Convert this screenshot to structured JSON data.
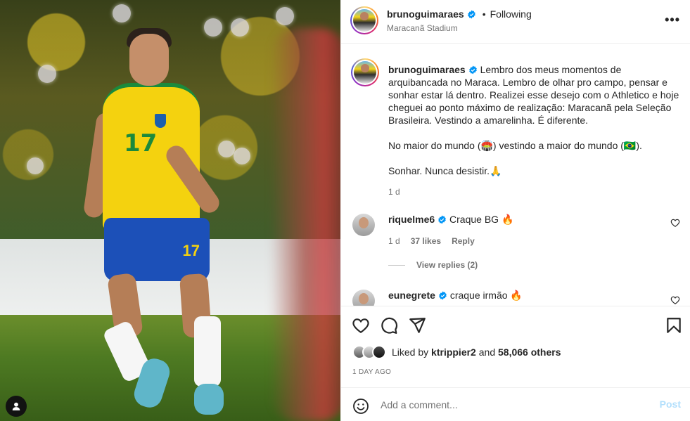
{
  "header": {
    "username": "brunoguimaraes",
    "separator": "•",
    "follow_status": "Following",
    "location": "Maracanã Stadium",
    "more_icon": "more-horizontal-icon",
    "more_label": "•••"
  },
  "caption": {
    "username": "brunoguimaraes",
    "text": "Lembro dos meus momentos de arquibancada no Maraca. Lembro de olhar pro campo, pensar e sonhar estar lá dentro. Realizei esse desejo com o Athletico e hoje cheguei ao ponto máximo de realização: Maracanã pela Seleção Brasileira. Vestindo a amarelinha. É diferente.\n\nNo maior do mundo (🏟️) vestindo a maior do mundo (🇧🇷).\n\nSonhar. Nunca desistir.🙏",
    "time": "1 d"
  },
  "comments": [
    {
      "username": "riquelme6",
      "text": "Craque BG 🔥",
      "time": "1 d",
      "likes": "37 likes",
      "reply_label": "Reply",
      "view_replies": "View replies (2)"
    },
    {
      "username": "eunegrete",
      "text": "craque irmão 🔥"
    }
  ],
  "actions": {
    "like_icon": "heart-icon",
    "comment_icon": "comment-icon",
    "share_icon": "send-icon",
    "save_icon": "bookmark-icon"
  },
  "likes": {
    "prefix": "Liked by",
    "user": "ktrippier2",
    "and": "and",
    "others": "58,066 others"
  },
  "posted": "1 DAY AGO",
  "add_comment": {
    "emoji_icon": "emoji-icon",
    "placeholder": "Add a comment...",
    "post_label": "Post"
  },
  "colors": {
    "verified": "#0095f6",
    "text": "#262626",
    "muted": "#737373",
    "post_disabled": "#b2dffc"
  }
}
